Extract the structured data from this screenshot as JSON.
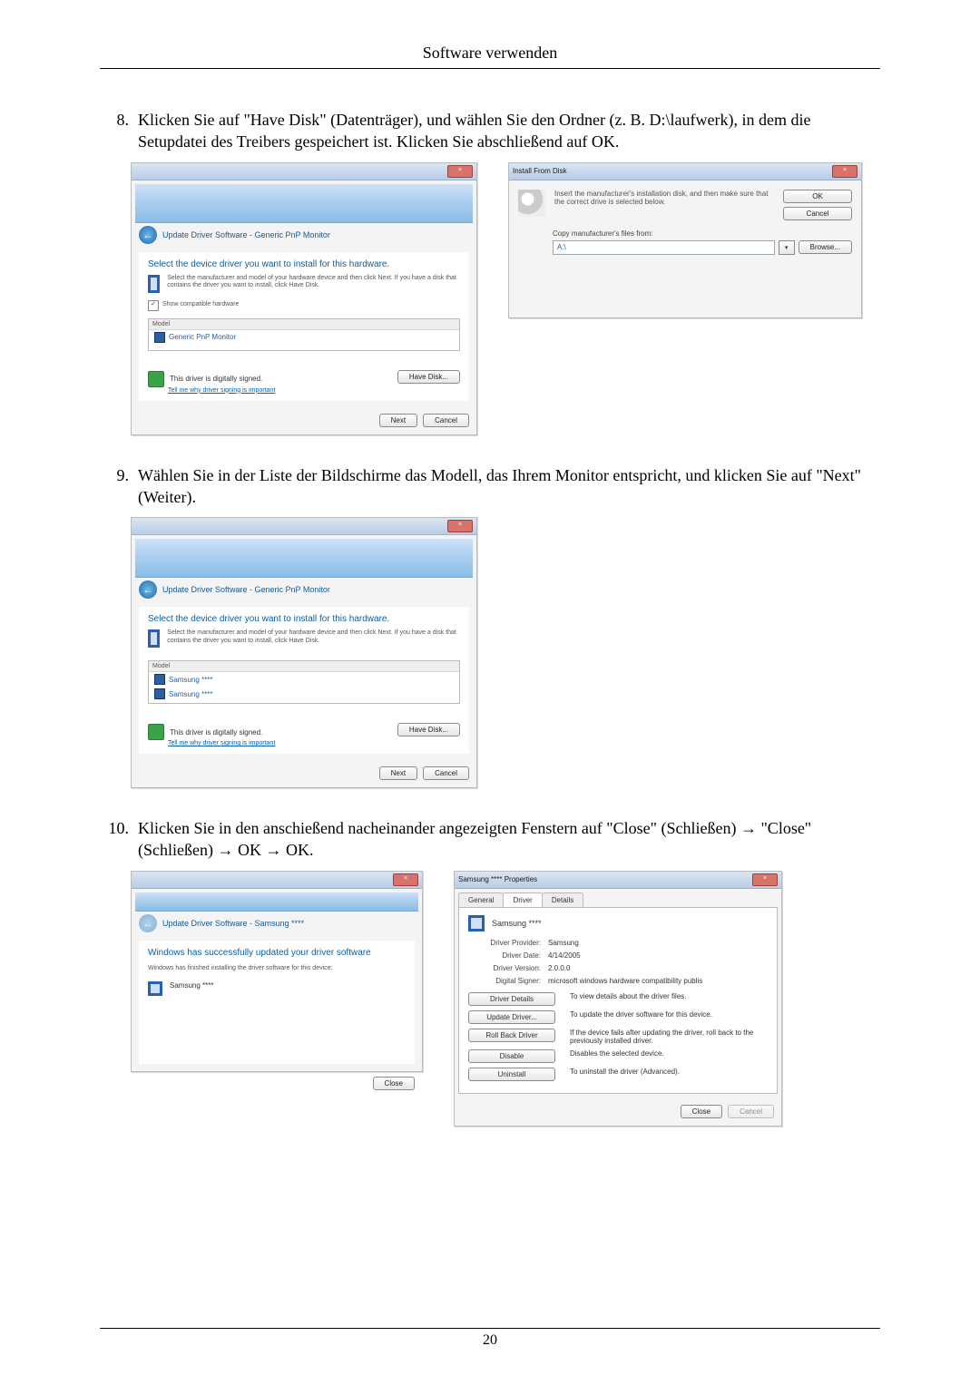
{
  "header": {
    "title": "Software verwenden"
  },
  "steps": {
    "s8_num": "8.",
    "s8_txt": "Klicken Sie auf \"Have Disk\" (Datenträger), und wählen Sie den Ordner (z. B. D:\\laufwerk), in dem die Setupdatei des Treibers gespeichert ist. Klicken Sie abschließend auf OK.",
    "s9_num": "9.",
    "s9_txt": "Wählen Sie in der Liste der Bildschirme das Modell, das Ihrem Monitor entspricht, und klicken Sie auf \"Next\" (Weiter).",
    "s10_num": "10.",
    "s10_txt": "Klicken Sie in den anschießend nacheinander angezeigten Fenstern auf \"Close\" (Schließen) → \"Close\" (Schließen) → OK → OK."
  },
  "wizard": {
    "breadcrumb_generic": "Update Driver Software - Generic PnP Monitor",
    "breadcrumb_samsung": "Update Driver Software - Samsung ****",
    "heading_select": "Select the device driver you want to install for this hardware.",
    "desc_select": "Select the manufacturer and model of your hardware device and then click Next. If you have a disk that contains the driver you want to install, click Have Disk.",
    "chk_compat": "Show compatible hardware",
    "list_header": "Model",
    "list_item_generic": "Generic PnP Monitor",
    "list_item_s1": "Samsung ****",
    "list_item_s2": "Samsung ****",
    "signed": "This driver is digitally signed.",
    "signed_link": "Tell me why driver signing is important",
    "btn_have_disk": "Have Disk...",
    "btn_next": "Next",
    "btn_cancel": "Cancel",
    "success_heading": "Windows has successfully updated your driver software",
    "success_desc": "Windows has finished installing the driver software for this device:",
    "success_item": "Samsung ****",
    "btn_close": "Close"
  },
  "install_disk": {
    "title": "Install From Disk",
    "msg": "Insert the manufacturer's installation disk, and then make sure that the correct drive is selected below.",
    "btn_ok": "OK",
    "btn_cancel": "Cancel",
    "copy_label": "Copy manufacturer's files from:",
    "path": "A:\\",
    "btn_browse": "Browse..."
  },
  "props": {
    "title": "Samsung **** Properties",
    "tab_general": "General",
    "tab_driver": "Driver",
    "tab_details": "Details",
    "device": "Samsung ****",
    "l_provider": "Driver Provider:",
    "v_provider": "Samsung",
    "l_date": "Driver Date:",
    "v_date": "4/14/2005",
    "l_version": "Driver Version:",
    "v_version": "2.0.0.0",
    "l_signer": "Digital Signer:",
    "v_signer": "microsoft windows hardware compatibility publis",
    "btn_details": "Driver Details",
    "txt_details": "To view details about the driver files.",
    "btn_update": "Update Driver...",
    "txt_update": "To update the driver software for this device.",
    "btn_rollback": "Roll Back Driver",
    "txt_rollback": "If the device fails after updating the driver, roll back to the previously installed driver.",
    "btn_disable": "Disable",
    "txt_disable": "Disables the selected device.",
    "btn_uninstall": "Uninstall",
    "txt_uninstall": "To uninstall the driver (Advanced).",
    "btn_close": "Close",
    "btn_cancel": "Cancel"
  },
  "page_number": "20"
}
